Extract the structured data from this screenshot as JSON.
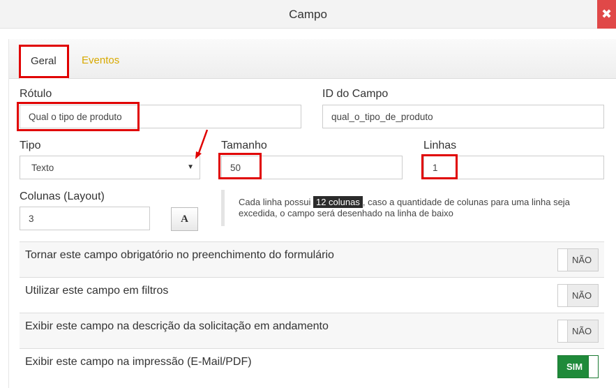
{
  "dialog": {
    "title": "Campo",
    "close_icon": "close-icon"
  },
  "tabs": [
    {
      "label": "Geral",
      "active": true
    },
    {
      "label": "Eventos",
      "active": false
    }
  ],
  "fields": {
    "rotulo": {
      "label": "Rótulo",
      "value": "Qual o tipo de produto"
    },
    "id_campo": {
      "label": "ID do Campo",
      "value": "qual_o_tipo_de_produto"
    },
    "tipo": {
      "label": "Tipo",
      "value": "Texto"
    },
    "tamanho": {
      "label": "Tamanho",
      "value": "50"
    },
    "linhas": {
      "label": "Linhas",
      "value": "1"
    },
    "colunas": {
      "label": "Colunas (Layout)",
      "value": "3"
    },
    "font_button": "A"
  },
  "hint": {
    "before": "Cada linha possui",
    "badge": "12 colunas",
    "after": ", caso a quantidade de colunas para uma linha seja excedida, o campo será desenhado na linha de baixo"
  },
  "options": [
    {
      "label": "Tornar este campo obrigatório no preenchimento do formulário",
      "toggle": "NÃO"
    },
    {
      "label": "Utilizar este campo em filtros",
      "toggle": "NÃO"
    },
    {
      "label": "Exibir este campo na descrição da solicitação em andamento",
      "toggle": "NÃO"
    },
    {
      "label": "Exibir este campo na impressão (E-Mail/PDF)",
      "toggle": "SIM"
    }
  ],
  "colors": {
    "accent_tab": "#d8a900",
    "highlight": "#e00000",
    "toggle_on": "#1f8a3a",
    "close": "#e04848"
  }
}
